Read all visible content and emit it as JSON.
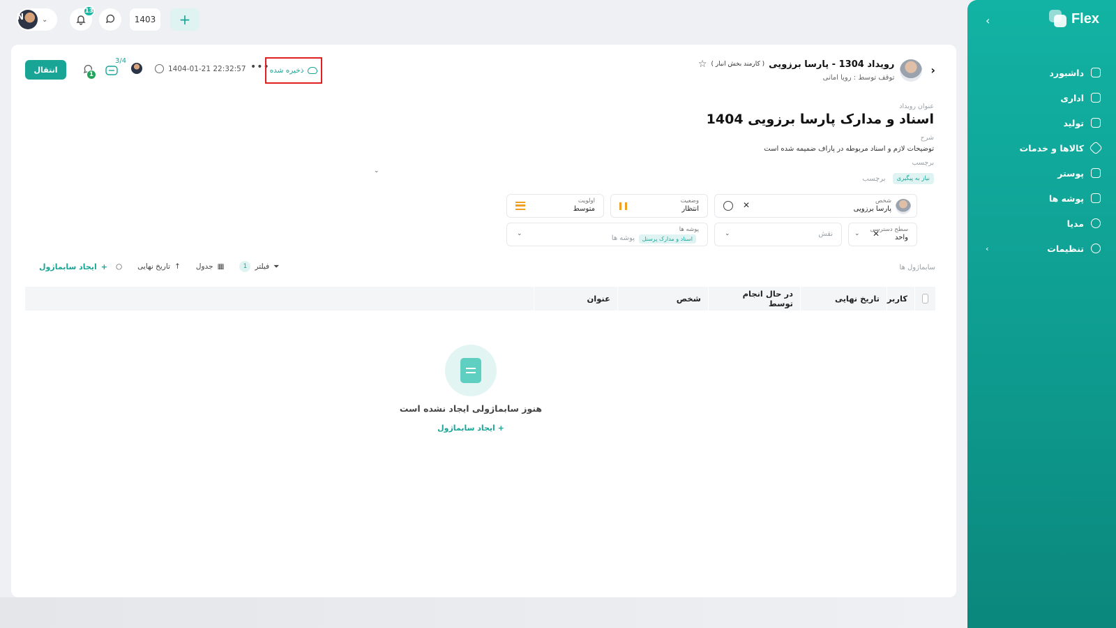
{
  "sidebar": {
    "logo": "Flex",
    "items": [
      {
        "label": "داشبورد",
        "icon": "home-icon"
      },
      {
        "label": "اداری",
        "icon": "briefcase-icon"
      },
      {
        "label": "تولید",
        "icon": "wrench-icon"
      },
      {
        "label": "کالاها و خدمات",
        "icon": "cube-icon"
      },
      {
        "label": "پوستر",
        "icon": "image-icon"
      },
      {
        "label": "پوشه ها",
        "icon": "folder-icon"
      },
      {
        "label": "مدیا",
        "icon": "globe-icon"
      },
      {
        "label": "تنظیمات",
        "icon": "gear-icon"
      }
    ]
  },
  "topbar": {
    "notifications_count": "13",
    "year": "1403"
  },
  "header": {
    "transfer_label": "انتقال",
    "chat_count": "1",
    "checklist": "3/4",
    "datetime": "1404-01-21 22:32:57",
    "saved_label": "ذخیره شده",
    "title": "رویداد 1304 - پارسا برزویی",
    "role": "( کارمند بخش انبار )",
    "subtitle": "توقف توسط : رویا امانی"
  },
  "event": {
    "title_label": "عنوان رویداد",
    "title": "اسناد و مدارک پارسا برزویی 1404",
    "desc_label": "شرح",
    "desc": "توضیحات لازم و اسناد مربوطه در پاراف ضمیمه شده است",
    "tag_label": "برچسب",
    "tag_pill": "نیاز به پیگیری",
    "tag_placeholder": "برچسب"
  },
  "fields": {
    "person_label": "شخص",
    "person_value": "پارسا برزویی",
    "status_label": "وضعیت",
    "status_value": "انتظار",
    "priority_label": "اولویت",
    "priority_value": "متوسط",
    "access_label": "سطح دسترسی",
    "access_value": "واحد",
    "role_placeholder": "نقش",
    "folders_label": "پوشه ها",
    "folders_pill": "اسناد و مدارک پرسنل",
    "folders_placeholder": "پوشه ها"
  },
  "subtasks": {
    "label": "سابماژول ها",
    "filter_label": "فیلتر",
    "filter_count": "1",
    "view_label": "جدول",
    "sort_label": "تاریخ نهایی",
    "create_label": "ایجاد سابماژول",
    "columns": [
      "کاربر",
      "تاریخ نهایی",
      "در حال انجام توسط",
      "شخص",
      "عنوان"
    ],
    "empty_text": "هنوز سابماژولی ایجاد نشده است",
    "empty_link": "ایجاد سابماژول"
  },
  "colors": {
    "accent": "#18a596",
    "warning": "#f0a020",
    "highlight": "#e02020"
  }
}
